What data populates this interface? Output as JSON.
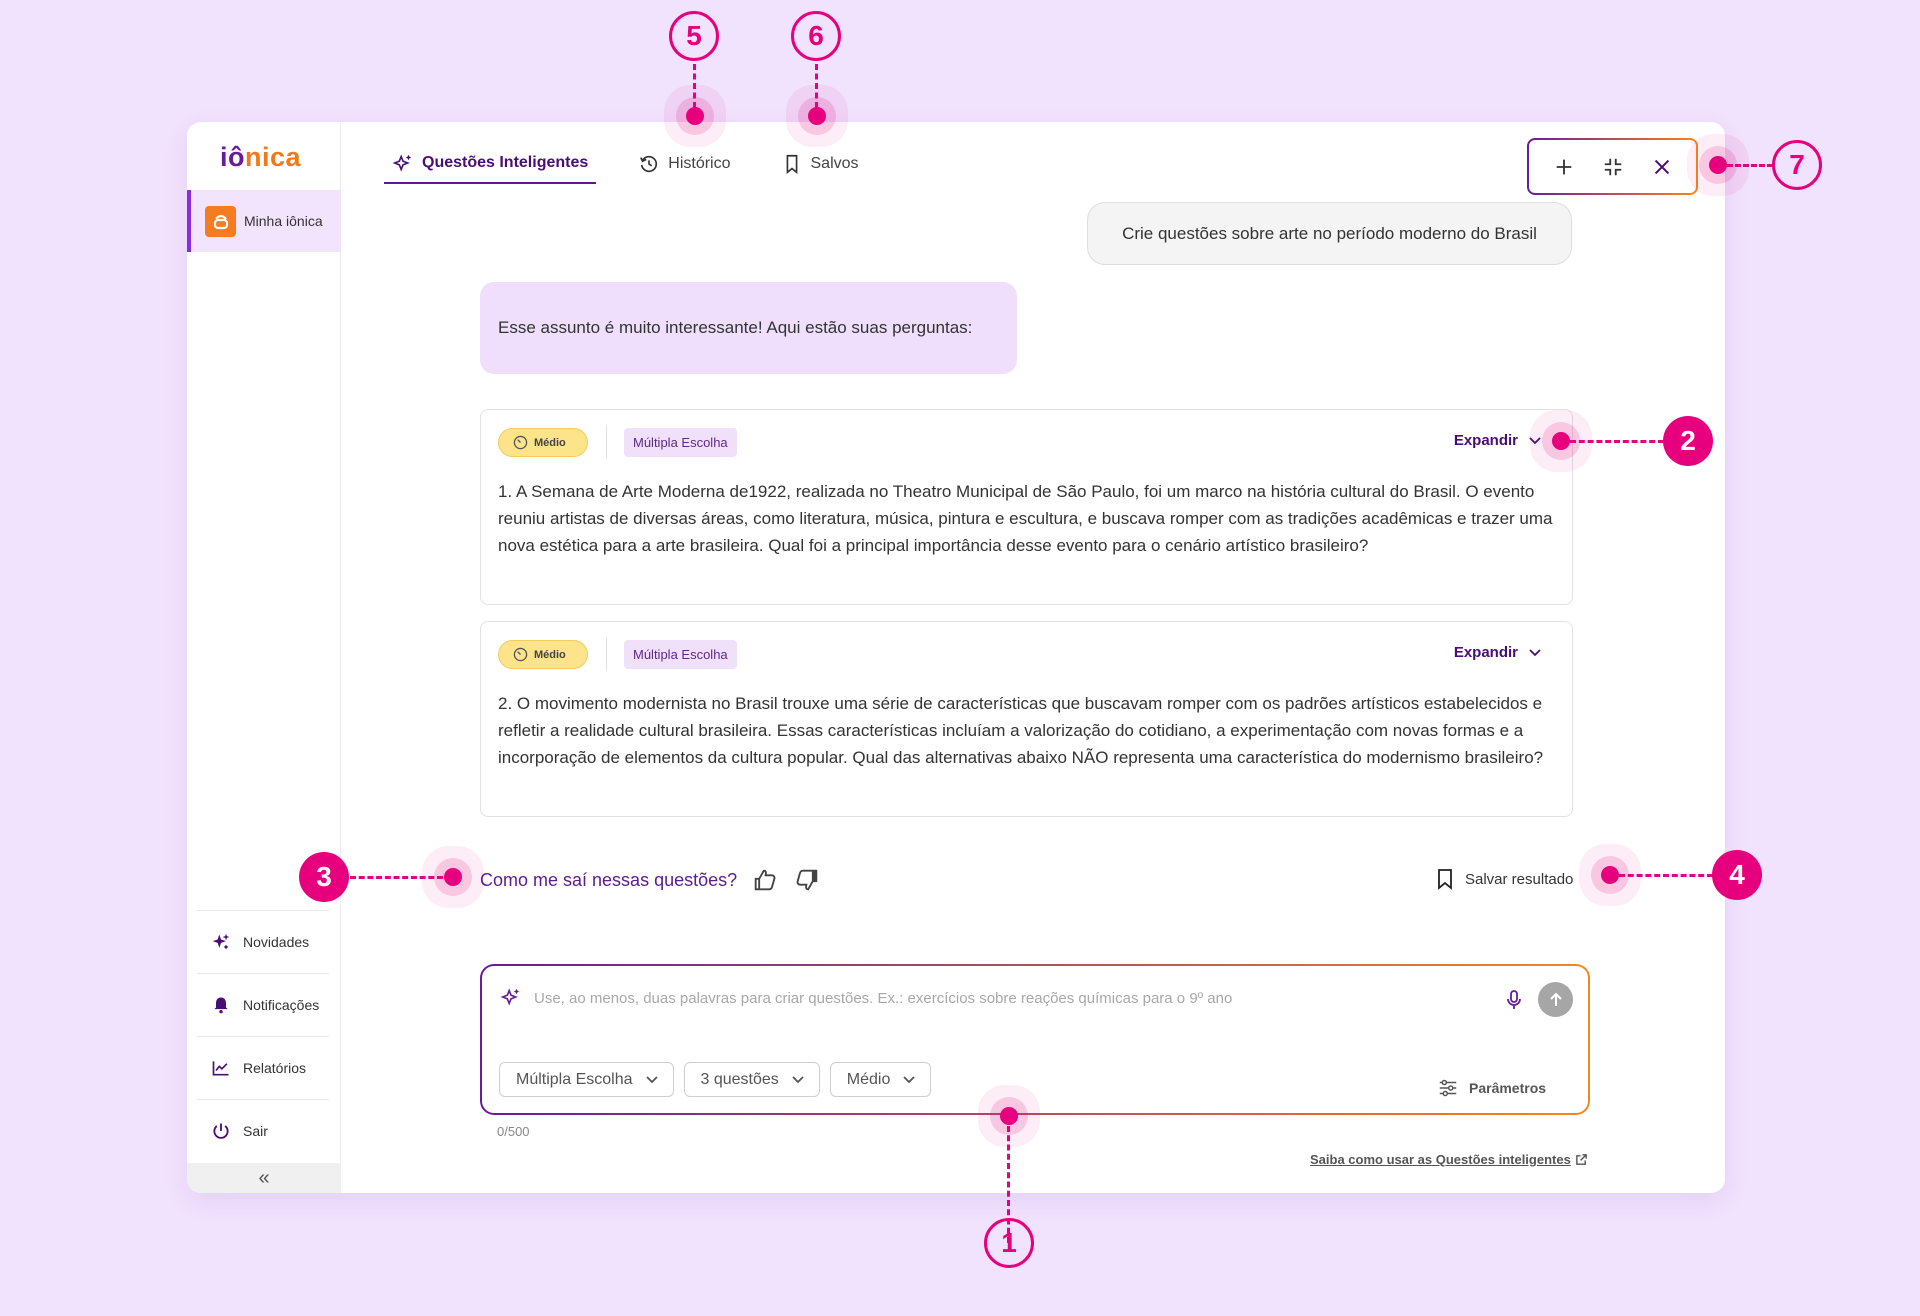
{
  "brand": {
    "logo_part1": "iô",
    "logo_part2": "nica"
  },
  "sidebar": {
    "active_item": {
      "label": "Minha iônica",
      "icon": "ionica-app-icon"
    },
    "bottom_items": [
      {
        "label": "Novidades",
        "icon": "sparkles-icon"
      },
      {
        "label": "Notificações",
        "icon": "bell-icon"
      },
      {
        "label": "Relatórios",
        "icon": "chart-line-icon"
      },
      {
        "label": "Sair",
        "icon": "power-icon"
      }
    ],
    "collapse_glyph": "«"
  },
  "tabs": [
    {
      "label": "Questões Inteligentes",
      "icon": "sparkles-icon",
      "active": true
    },
    {
      "label": "Histórico",
      "icon": "history-icon",
      "active": false
    },
    {
      "label": "Salvos",
      "icon": "bookmark-icon",
      "active": false
    }
  ],
  "window_controls": [
    "plus-icon",
    "minimize-icon",
    "close-icon"
  ],
  "chat": {
    "user_message": "Crie questões sobre arte no período moderno do Brasil",
    "bot_message": "Esse assunto é muito interessante! Aqui estão suas perguntas:"
  },
  "questions": [
    {
      "level": "Médio",
      "type": "Múltipla Escolha",
      "expand_label": "Expandir",
      "text": "1. A Semana de Arte Moderna de1922, realizada no Theatro Municipal de São Paulo, foi um marco na história cultural do Brasil. O evento reuniu artistas de diversas áreas, como literatura, música, pintura e escultura, e buscava romper com as tradições acadêmicas e trazer uma nova estética para a arte brasileira. Qual foi a principal importância desse evento para o cenário artístico brasileiro?"
    },
    {
      "level": "Médio",
      "type": "Múltipla Escolha",
      "expand_label": "Expandir",
      "text": "2. O movimento modernista no Brasil trouxe uma série de características que buscavam romper com os padrões artísticos estabelecidos e refletir a realidade cultural brasileira. Essas características incluíam a valorização do cotidiano, a experimentação com novas formas e a incorporação de elementos da cultura popular. Qual das alternativas abaixo NÃO representa uma característica do modernismo brasileiro?"
    }
  ],
  "feedback": {
    "prompt": "Como me saí nessas questões?"
  },
  "save_result_label": "Salvar resultado",
  "composer": {
    "placeholder": "Use, ao menos, duas palavras para criar questões. Ex.: exercícios sobre reações químicas para o 9º ano",
    "selects": [
      "Múltipla Escolha",
      "3 questões",
      "Médio"
    ],
    "params_label": "Parâmetros",
    "char_count": "0/500"
  },
  "help_link": "Saiba como usar as Questões inteligentes",
  "callouts": [
    "1",
    "2",
    "3",
    "4",
    "5",
    "6",
    "7"
  ],
  "colors": {
    "accent_purple": "#5c1a8e",
    "accent_orange": "#f5871f",
    "callout_pink": "#e6007e",
    "background": "#f1e2fd"
  }
}
